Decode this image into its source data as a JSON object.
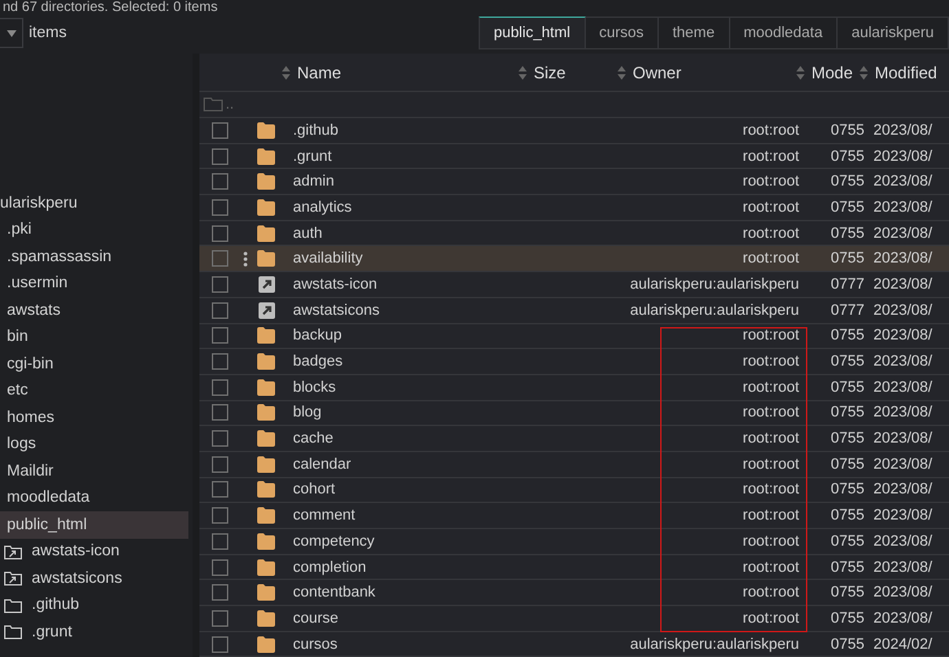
{
  "status_line": "nd 67 directories. Selected: 0 items",
  "view_select": {
    "label": "items"
  },
  "tabs": [
    {
      "label": "public_html",
      "selected": true
    },
    {
      "label": "cursos",
      "selected": false
    },
    {
      "label": "theme",
      "selected": false
    },
    {
      "label": "moodledata",
      "selected": false
    },
    {
      "label": "aulariskperu",
      "selected": false
    }
  ],
  "tree": [
    {
      "label": "ulariskperu",
      "selected": false,
      "children": [
        {
          "label": ".pki",
          "selected": false
        },
        {
          "label": ".spamassassin",
          "selected": false
        },
        {
          "label": ".usermin",
          "selected": false
        },
        {
          "label": "awstats",
          "selected": false
        },
        {
          "label": "bin",
          "selected": false
        },
        {
          "label": "cgi-bin",
          "selected": false
        },
        {
          "label": "etc",
          "selected": false
        },
        {
          "label": "homes",
          "selected": false
        },
        {
          "label": "logs",
          "selected": false
        },
        {
          "label": "Maildir",
          "selected": false
        },
        {
          "label": "moodledata",
          "selected": false
        },
        {
          "label": "public_html",
          "selected": true,
          "children": [
            {
              "label": "awstats-icon",
              "kind": "symlink",
              "selected": false
            },
            {
              "label": "awstatsicons",
              "kind": "symlink",
              "selected": false
            },
            {
              "label": ".github",
              "kind": "folder",
              "selected": false
            },
            {
              "label": ".grunt",
              "kind": "folder",
              "selected": false
            }
          ]
        }
      ]
    }
  ],
  "table": {
    "columns": [
      "Name",
      "Size",
      "Owner",
      "Mode",
      "Modified"
    ],
    "parent_row": "..",
    "rows": [
      {
        "kind": "folder",
        "name": ".github",
        "owner": "root:root",
        "mode": "0755",
        "modified": "2023/08/",
        "checked": false,
        "highlighted": false
      },
      {
        "kind": "folder",
        "name": ".grunt",
        "owner": "root:root",
        "mode": "0755",
        "modified": "2023/08/",
        "checked": false,
        "highlighted": false
      },
      {
        "kind": "folder",
        "name": "admin",
        "owner": "root:root",
        "mode": "0755",
        "modified": "2023/08/",
        "checked": false,
        "highlighted": false
      },
      {
        "kind": "folder",
        "name": "analytics",
        "owner": "root:root",
        "mode": "0755",
        "modified": "2023/08/",
        "checked": false,
        "highlighted": false
      },
      {
        "kind": "folder",
        "name": "auth",
        "owner": "root:root",
        "mode": "0755",
        "modified": "2023/08/",
        "checked": false,
        "highlighted": false
      },
      {
        "kind": "folder",
        "name": "availability",
        "owner": "root:root",
        "mode": "0755",
        "modified": "2023/08/",
        "checked": false,
        "highlighted": true
      },
      {
        "kind": "symlink",
        "name": "awstats-icon",
        "owner": "aulariskperu:aulariskperu",
        "mode": "0777",
        "modified": "2023/08/",
        "checked": false,
        "highlighted": false
      },
      {
        "kind": "symlink",
        "name": "awstatsicons",
        "owner": "aulariskperu:aulariskperu",
        "mode": "0777",
        "modified": "2023/08/",
        "checked": false,
        "highlighted": false
      },
      {
        "kind": "folder",
        "name": "backup",
        "owner": "root:root",
        "mode": "0755",
        "modified": "2023/08/",
        "checked": false,
        "highlighted": false
      },
      {
        "kind": "folder",
        "name": "badges",
        "owner": "root:root",
        "mode": "0755",
        "modified": "2023/08/",
        "checked": false,
        "highlighted": false
      },
      {
        "kind": "folder",
        "name": "blocks",
        "owner": "root:root",
        "mode": "0755",
        "modified": "2023/08/",
        "checked": false,
        "highlighted": false
      },
      {
        "kind": "folder",
        "name": "blog",
        "owner": "root:root",
        "mode": "0755",
        "modified": "2023/08/",
        "checked": false,
        "highlighted": false
      },
      {
        "kind": "folder",
        "name": "cache",
        "owner": "root:root",
        "mode": "0755",
        "modified": "2023/08/",
        "checked": false,
        "highlighted": false
      },
      {
        "kind": "folder",
        "name": "calendar",
        "owner": "root:root",
        "mode": "0755",
        "modified": "2023/08/",
        "checked": false,
        "highlighted": false
      },
      {
        "kind": "folder",
        "name": "cohort",
        "owner": "root:root",
        "mode": "0755",
        "modified": "2023/08/",
        "checked": false,
        "highlighted": false
      },
      {
        "kind": "folder",
        "name": "comment",
        "owner": "root:root",
        "mode": "0755",
        "modified": "2023/08/",
        "checked": false,
        "highlighted": false
      },
      {
        "kind": "folder",
        "name": "competency",
        "owner": "root:root",
        "mode": "0755",
        "modified": "2023/08/",
        "checked": false,
        "highlighted": false
      },
      {
        "kind": "folder",
        "name": "completion",
        "owner": "root:root",
        "mode": "0755",
        "modified": "2023/08/",
        "checked": false,
        "highlighted": false
      },
      {
        "kind": "folder",
        "name": "contentbank",
        "owner": "root:root",
        "mode": "0755",
        "modified": "2023/08/",
        "checked": false,
        "highlighted": false
      },
      {
        "kind": "folder",
        "name": "course",
        "owner": "root:root",
        "mode": "0755",
        "modified": "2023/08/",
        "checked": false,
        "highlighted": false
      },
      {
        "kind": "folder",
        "name": "cursos",
        "owner": "aulariskperu:aulariskperu",
        "mode": "0755",
        "modified": "2024/02/",
        "checked": false,
        "highlighted": false
      }
    ]
  }
}
